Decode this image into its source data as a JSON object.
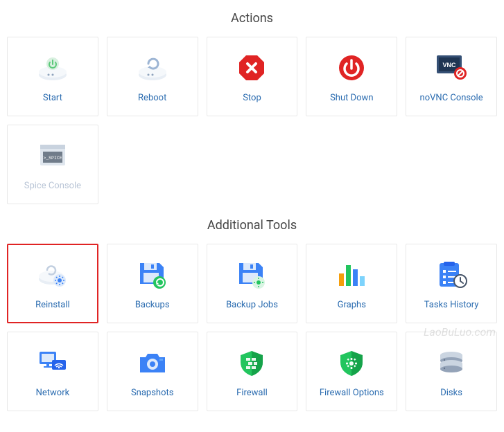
{
  "sections": {
    "actions": {
      "title": "Actions",
      "items": [
        {
          "label": "Start"
        },
        {
          "label": "Reboot"
        },
        {
          "label": "Stop"
        },
        {
          "label": "Shut Down"
        },
        {
          "label": "noVNC Console"
        },
        {
          "label": "Spice Console"
        }
      ]
    },
    "tools": {
      "title": "Additional Tools",
      "items": [
        {
          "label": "Reinstall"
        },
        {
          "label": "Backups"
        },
        {
          "label": "Backup Jobs"
        },
        {
          "label": "Graphs"
        },
        {
          "label": "Tasks History"
        },
        {
          "label": "Network"
        },
        {
          "label": "Snapshots"
        },
        {
          "label": "Firewall"
        },
        {
          "label": "Firewall Options"
        },
        {
          "label": "Disks"
        }
      ]
    }
  },
  "watermark": "LaoBuLuo.com",
  "colors": {
    "link": "#2b6cb0",
    "highlight": "#e02424",
    "border": "#e8e8e8"
  }
}
